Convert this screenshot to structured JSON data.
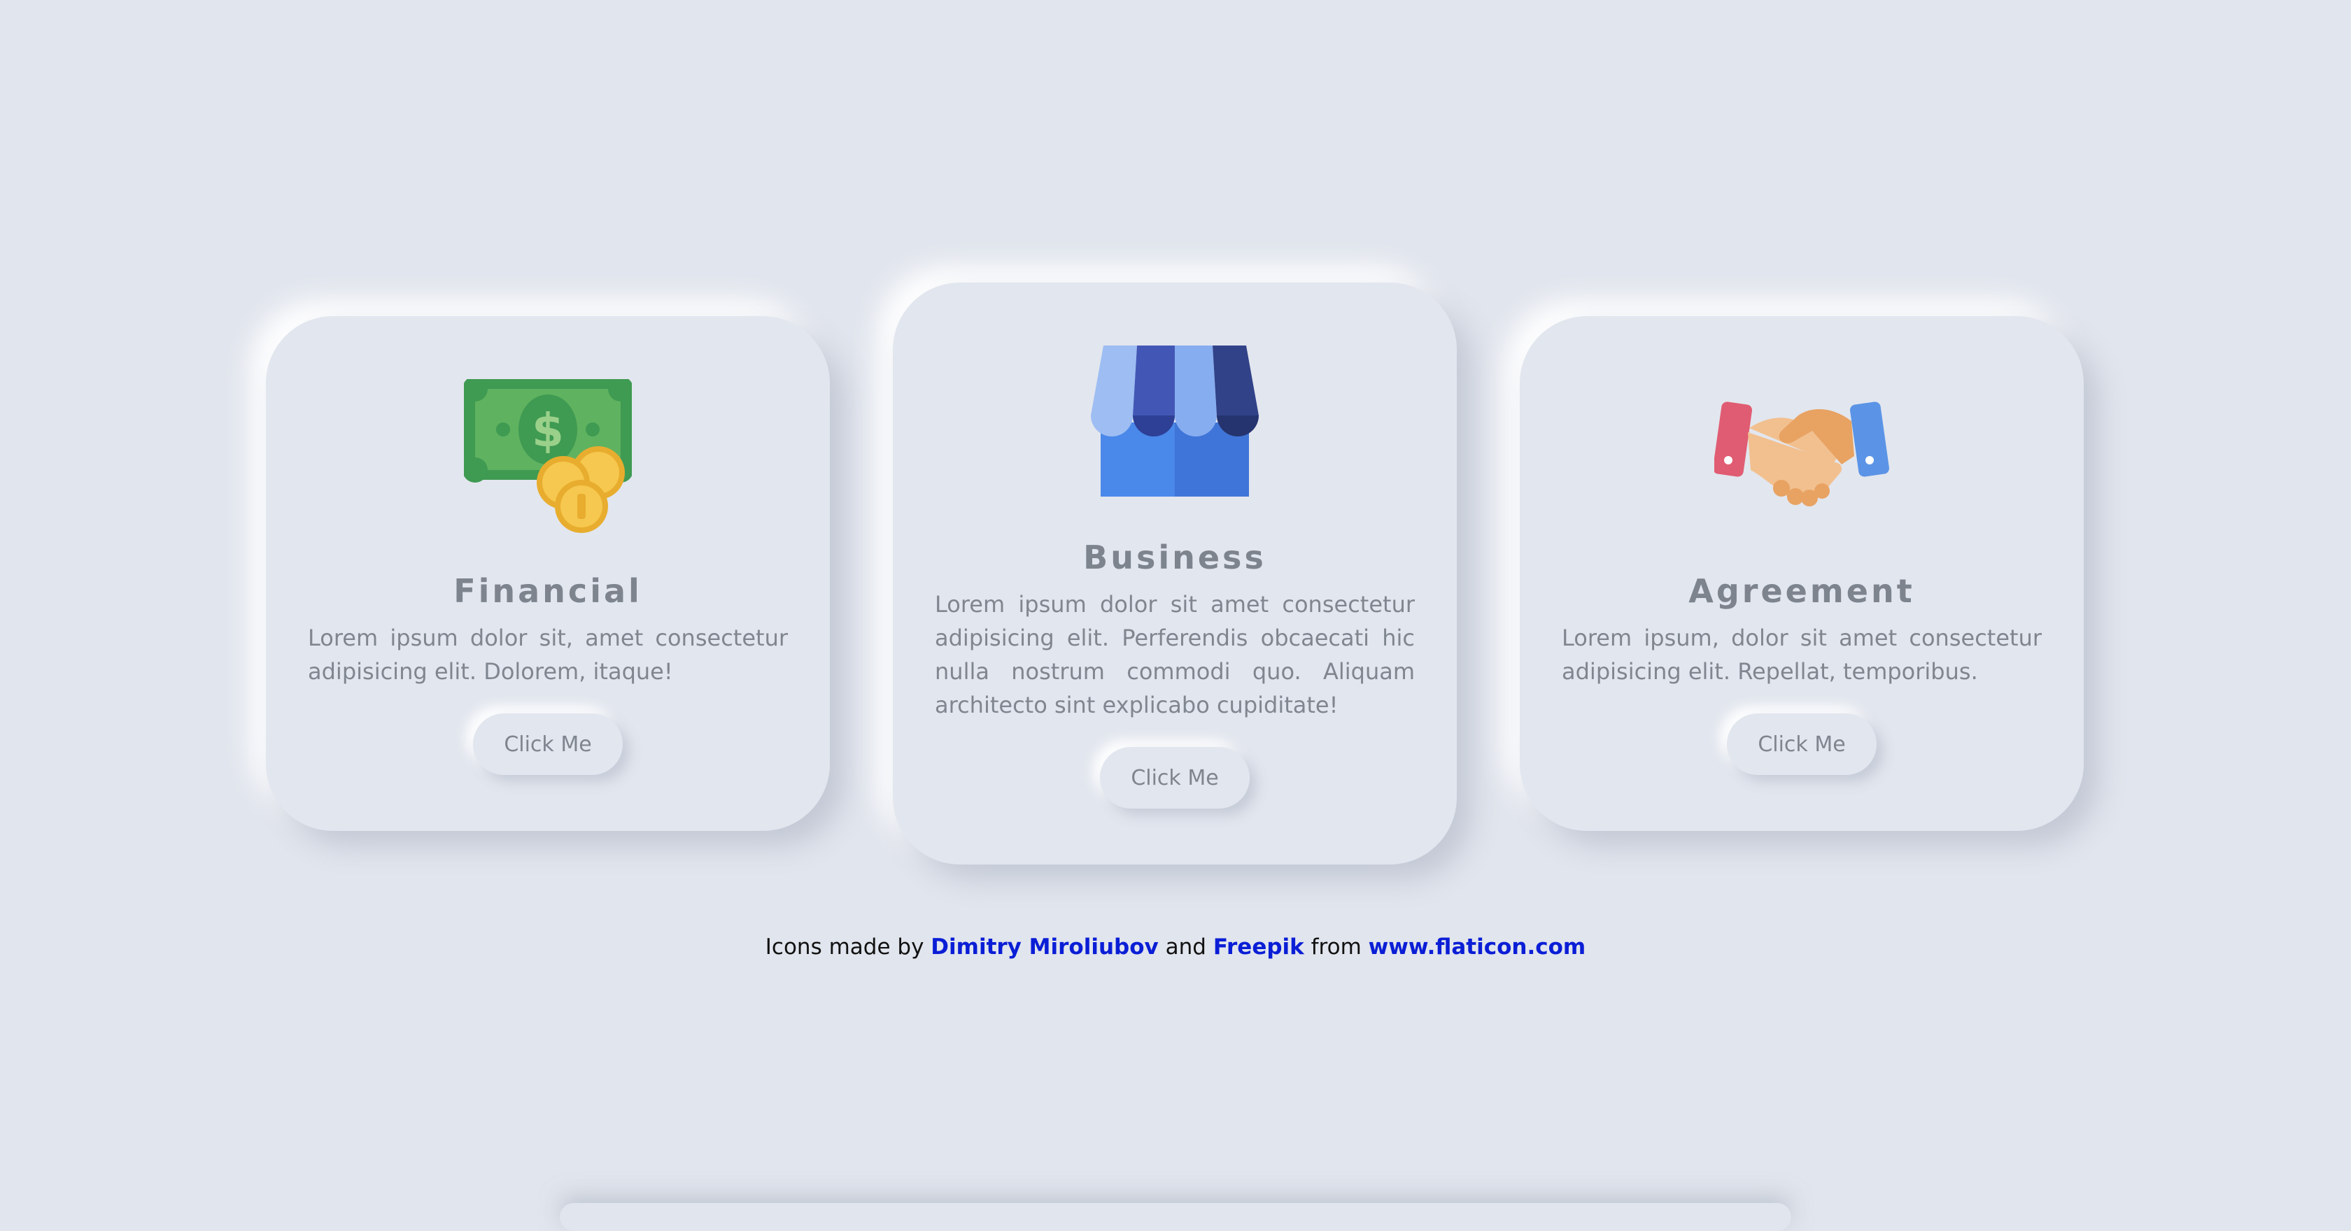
{
  "cards": [
    {
      "icon": "money-coins-icon",
      "title": "Financial",
      "description": "Lorem ipsum dolor sit, amet consectetur adipisicing elit. Dolorem, itaque!",
      "button_label": "Click Me"
    },
    {
      "icon": "store-icon",
      "title": "Business",
      "description": "Lorem ipsum dolor sit amet consectetur adipisicing elit. Perferendis obcaecati hic nulla nostrum commodi quo. Aliquam architecto sint explicabo cupiditate!",
      "button_label": "Click Me"
    },
    {
      "icon": "handshake-icon",
      "title": "Agreement",
      "description": "Lorem ipsum, dolor sit amet consectetur adipisicing elit. Repellat, temporibus.",
      "button_label": "Click Me"
    }
  ],
  "credit": {
    "prefix": "Icons made by",
    "author1": "Dimitry Miroliubov",
    "and": "and",
    "author2": "Freepik",
    "from": "from",
    "site": "www.flaticon.com"
  },
  "colors": {
    "background": "#e1e5ed",
    "title": "#7d848e",
    "text": "#80868f",
    "link": "#0a1ed6"
  }
}
